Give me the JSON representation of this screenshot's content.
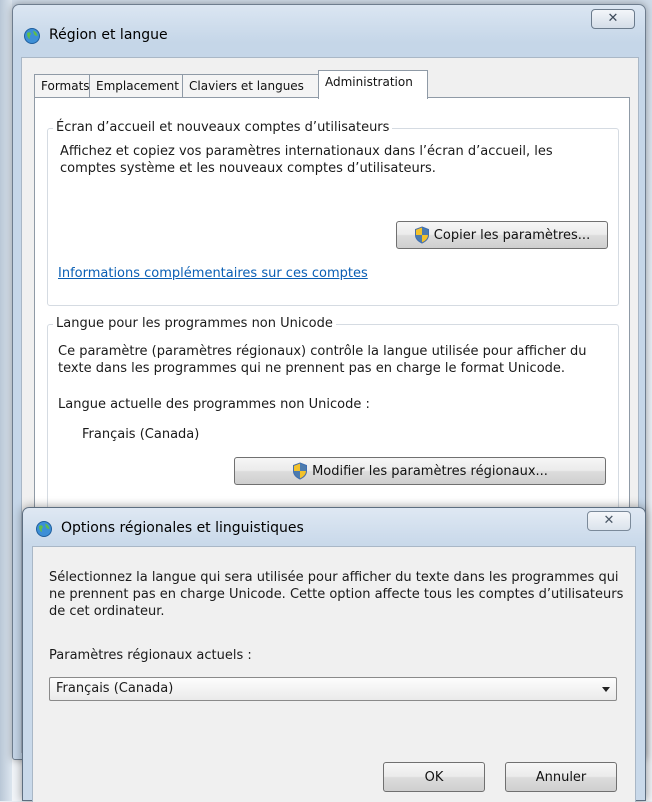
{
  "main_window": {
    "title": "Région et langue",
    "close_glyph": "✕",
    "tabs": [
      {
        "label": "Formats"
      },
      {
        "label": "Emplacement"
      },
      {
        "label": "Claviers et langues"
      },
      {
        "label": "Administration",
        "active": true
      }
    ],
    "welcome_group": {
      "legend": "Écran d’accueil et nouveaux comptes d’utilisateurs",
      "description": "Affichez et copiez vos paramètres internationaux dans l’écran d’accueil, les comptes système et les nouveaux comptes d’utilisateurs.",
      "copy_button": "Copier les paramètres...",
      "more_info_link": "Informations complémentaires sur ces comptes"
    },
    "unicode_group": {
      "legend": "Langue pour les programmes non Unicode",
      "description": "Ce paramètre (paramètres régionaux) contrôle la langue utilisée pour afficher du texte dans les programmes qui ne prennent pas en charge le format Unicode.",
      "current_label": "Langue actuelle des programmes non Unicode :",
      "current_value": "Français (Canada)",
      "change_button": "Modifier les paramètres régionaux..."
    }
  },
  "dialog": {
    "title": "Options régionales et linguistiques",
    "close_glyph": "✕",
    "description": "Sélectionnez la langue qui sera utilisée pour afficher du texte dans les programmes qui ne prennent pas en charge Unicode. Cette option affecte tous les comptes d’utilisateurs de cet ordinateur.",
    "current_label": "Paramètres régionaux actuels :",
    "selected_locale": "Français (Canada)",
    "ok_button": "OK",
    "cancel_button": "Annuler"
  },
  "icons": {
    "window_icon": "globe-icon",
    "shield_icon": "uac-shield-icon",
    "dropdown_icon": "chevron-down-icon"
  },
  "colors": {
    "link": "#0a5fb4",
    "title_bar": "#c5d6e8",
    "panel": "#ffffff"
  }
}
